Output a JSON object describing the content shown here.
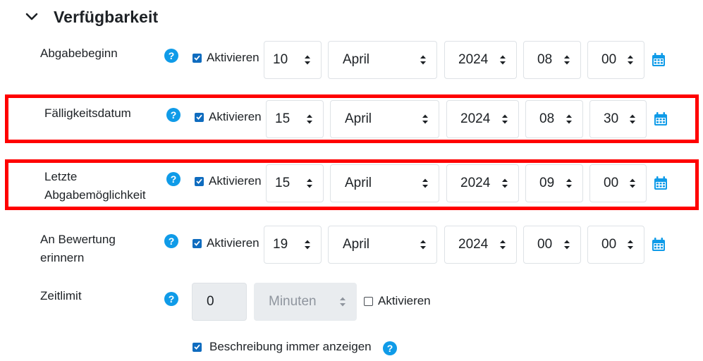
{
  "section": {
    "title": "Verfügbarkeit",
    "icon": "chevron-down-icon"
  },
  "rows": [
    {
      "label": "Abgabebeginn",
      "enable_label": "Aktivieren",
      "enabled": true,
      "day": "10",
      "month": "April",
      "year": "2024",
      "hour": "08",
      "minute": "00"
    },
    {
      "label": "Fälligkeitsdatum",
      "enable_label": "Aktivieren",
      "enabled": true,
      "highlighted": true,
      "day": "15",
      "month": "April",
      "year": "2024",
      "hour": "08",
      "minute": "30"
    },
    {
      "label_line1": "Letzte",
      "label_line2": "Abgabemöglichkeit",
      "enable_label": "Aktivieren",
      "enabled": true,
      "highlighted": true,
      "day": "15",
      "month": "April",
      "year": "2024",
      "hour": "09",
      "minute": "00"
    },
    {
      "label_line1": "An Bewertung",
      "label_line2": "erinnern",
      "enable_label": "Aktivieren",
      "enabled": true,
      "day": "19",
      "month": "April",
      "year": "2024",
      "hour": "00",
      "minute": "00"
    }
  ],
  "time_limit": {
    "label": "Zeitlimit",
    "value": "0",
    "unit": "Minuten",
    "enable_label": "Aktivieren",
    "enabled": false
  },
  "description": {
    "label": "Beschreibung immer anzeigen",
    "checked": true
  },
  "colors": {
    "accent": "#0f6cbf",
    "help": "#0f9be8",
    "highlight": "#ff0000"
  }
}
